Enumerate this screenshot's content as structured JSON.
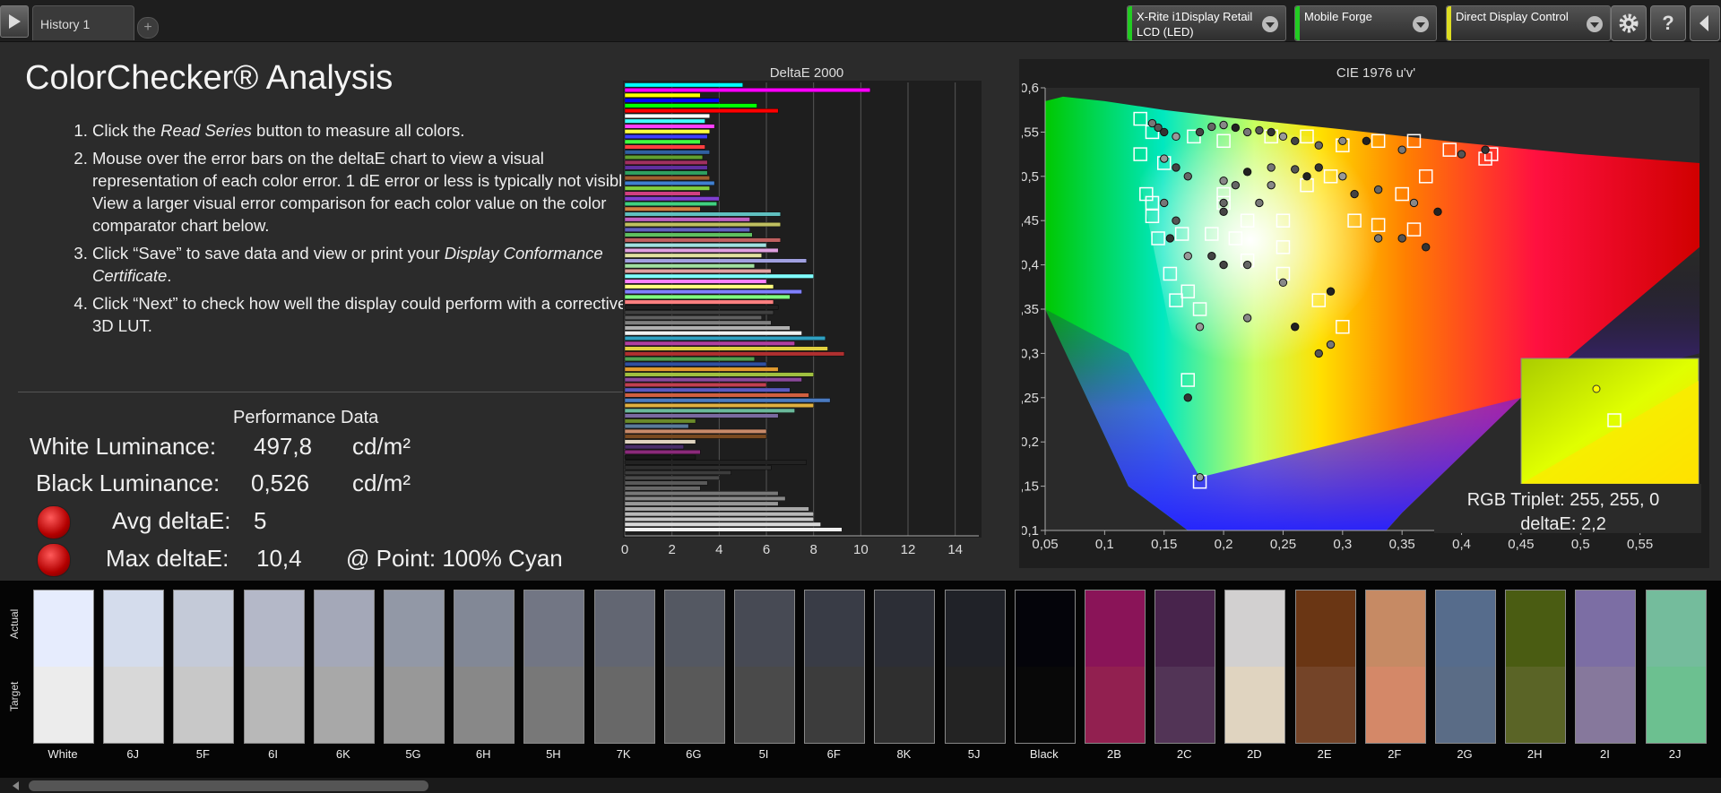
{
  "tabs": {
    "history": "History 1",
    "add": "+"
  },
  "devices": [
    {
      "line1": "X-Rite i1Display Retail",
      "line2": "LCD (LED)",
      "status_color": "#22cc22"
    },
    {
      "line1": "Mobile Forge",
      "line2": "",
      "status_color": "#22cc22"
    },
    {
      "line1": "Direct Display Control",
      "line2": "",
      "status_color": "#dddd22"
    }
  ],
  "toolbar": {
    "help": "?"
  },
  "title": "ColorChecker® Analysis",
  "instructions": {
    "s1_pre": "Click the ",
    "s1_em": "Read Series",
    "s1_post": " button to measure all colors.",
    "s2a": "Mouse over the error bars on the deltaE chart to view a visual representation of each color error. 1 dE error or less is typically not visible.",
    "s2b": "View a larger visual error comparison for each color value on the color comparator chart below.",
    "s3_pre": "Click “Save” to save data and view or print your ",
    "s3_em": "Display Conformance Certificate",
    "s3_post": ".",
    "s4": "Click “Next” to check how well the display could perform with a corrective 3D LUT."
  },
  "performance": {
    "title": "Performance Data",
    "white_label": "White Luminance:",
    "white_value": "497,8",
    "white_unit": "cd/m²",
    "black_label": "Black Luminance:",
    "black_value": "0,526",
    "black_unit": "cd/m²",
    "avg_label": "Avg deltaE:",
    "avg_value": "5",
    "max_label": "Max deltaE:",
    "max_value": "10,4",
    "max_point": "@ Point: 100% Cyan"
  },
  "chart_data": [
    {
      "type": "bar",
      "orientation": "horizontal",
      "title": "DeltaE 2000",
      "xlim": [
        0,
        15
      ],
      "xticks": [
        0,
        2,
        4,
        6,
        8,
        10,
        12,
        14
      ],
      "bar_colors": [
        "#f0f0f0",
        "#d8d8d8",
        "#c8c8c8",
        "#b8b8b8",
        "#a8a8a8",
        "#989898",
        "#888888",
        "#787878",
        "#686868",
        "#5a5a5a",
        "#4a4a4a",
        "#3c3c3c",
        "#2e2e2e",
        "#222222",
        "#181818",
        "#8a2a7a",
        "#4a2e6a",
        "#e0d4c0",
        "#7a4a20",
        "#c88a6a",
        "#5a7a9a",
        "#6a8a2a",
        "#7a6aa0",
        "#6ab89a",
        "#e0b040",
        "#4a7ac0",
        "#d06040",
        "#5a5ac0",
        "#c04050",
        "#8a4a9a",
        "#a0c040",
        "#e09a30",
        "#3050a0",
        "#50a050",
        "#b03030",
        "#e0d040",
        "#b040a0",
        "#30a0c0",
        "#f0f0f0",
        "#b0b0b0",
        "#808080",
        "#606060",
        "#404040",
        "#202020",
        "#ff8080",
        "#80ff80",
        "#8080ff",
        "#ffff80",
        "#ff80ff",
        "#80ffff",
        "#e0a0a0",
        "#a0e0a0",
        "#a0a0e0",
        "#e0e0a0",
        "#e0a0e0",
        "#a0e0e0",
        "#c06060",
        "#60c060",
        "#6060c0",
        "#c0c060",
        "#c060c0",
        "#60c0c0",
        "#d08040",
        "#40d080",
        "#8040d0",
        "#d04080",
        "#80d040",
        "#4080d0",
        "#a06030",
        "#30a060",
        "#6030a0",
        "#a03060",
        "#60a030",
        "#3060a0",
        "#ff4040",
        "#40ff40",
        "#4040ff",
        "#ffff40",
        "#ff40ff",
        "#40ffff",
        "#ffffff",
        "#ff0000",
        "#00ff00",
        "#0000ff",
        "#ffff00",
        "#ff00ff",
        "#00ffff"
      ],
      "values": [
        9.2,
        8.3,
        8.0,
        8.0,
        7.8,
        6.5,
        6.8,
        6.5,
        3.2,
        3.5,
        4.0,
        4.5,
        6.2,
        7.7,
        3.0,
        3.2,
        2.5,
        3.0,
        6.0,
        6.0,
        2.7,
        3.0,
        6.5,
        7.2,
        8.0,
        8.7,
        7.8,
        7.0,
        6.0,
        7.5,
        8.0,
        6.5,
        6.0,
        5.5,
        9.3,
        8.6,
        7.2,
        8.5,
        7.5,
        7.0,
        6.2,
        5.8,
        6.3,
        6.5,
        6.3,
        7.0,
        7.5,
        6.3,
        6.0,
        8.0,
        6.2,
        5.5,
        7.7,
        5.8,
        6.5,
        6.0,
        6.6,
        5.4,
        5.3,
        6.6,
        5.3,
        6.6,
        3.2,
        3.9,
        4.0,
        3.2,
        3.6,
        3.8,
        3.6,
        3.5,
        3.5,
        3.5,
        3.3,
        3.6,
        3.4,
        3.2,
        3.5,
        3.6,
        3.8,
        3.4,
        3.6,
        6.5,
        5.6,
        4.0,
        3.2,
        10.4,
        5.0
      ]
    },
    {
      "type": "scatter",
      "title": "CIE 1976 u'v'",
      "xlim": [
        0.05,
        0.6
      ],
      "ylim": [
        0.1,
        0.6
      ],
      "xticks": [
        "0,05",
        "0,1",
        "0,15",
        "0,2",
        "0,25",
        "0,3",
        "0,35",
        "0,4",
        "0,45",
        "0,5",
        "0,55"
      ],
      "yticks": [
        "0,1",
        "0,15",
        "0,2",
        "0,25",
        "0,3",
        "0,35",
        "0,4",
        "0,45",
        "0,5",
        "0,55",
        "0,6"
      ],
      "series": [
        {
          "kind": "measured",
          "points": [
            [
              0.14,
              0.56
            ],
            [
              0.145,
              0.555
            ],
            [
              0.15,
              0.55
            ],
            [
              0.16,
              0.545
            ],
            [
              0.18,
              0.55
            ],
            [
              0.19,
              0.556
            ],
            [
              0.2,
              0.558
            ],
            [
              0.21,
              0.555
            ],
            [
              0.22,
              0.55
            ],
            [
              0.23,
              0.552
            ],
            [
              0.24,
              0.55
            ],
            [
              0.25,
              0.545
            ],
            [
              0.26,
              0.54
            ],
            [
              0.28,
              0.535
            ],
            [
              0.3,
              0.54
            ],
            [
              0.32,
              0.54
            ],
            [
              0.35,
              0.53
            ],
            [
              0.4,
              0.525
            ],
            [
              0.42,
              0.53
            ],
            [
              0.15,
              0.52
            ],
            [
              0.16,
              0.51
            ],
            [
              0.17,
              0.5
            ],
            [
              0.2,
              0.495
            ],
            [
              0.22,
              0.505
            ],
            [
              0.24,
              0.51
            ],
            [
              0.26,
              0.508
            ],
            [
              0.28,
              0.51
            ],
            [
              0.3,
              0.5
            ],
            [
              0.31,
              0.48
            ],
            [
              0.33,
              0.485
            ],
            [
              0.36,
              0.47
            ],
            [
              0.38,
              0.46
            ],
            [
              0.15,
              0.47
            ],
            [
              0.16,
              0.45
            ],
            [
              0.155,
              0.43
            ],
            [
              0.17,
              0.41
            ],
            [
              0.2,
              0.4
            ],
            [
              0.22,
              0.4
            ],
            [
              0.25,
              0.38
            ],
            [
              0.29,
              0.37
            ],
            [
              0.33,
              0.43
            ],
            [
              0.35,
              0.43
            ],
            [
              0.37,
              0.42
            ],
            [
              0.18,
              0.33
            ],
            [
              0.2,
              0.46
            ],
            [
              0.2,
              0.47
            ],
            [
              0.22,
              0.34
            ],
            [
              0.26,
              0.33
            ],
            [
              0.29,
              0.31
            ],
            [
              0.28,
              0.3
            ],
            [
              0.17,
              0.25
            ],
            [
              0.18,
              0.16
            ],
            [
              0.19,
              0.41
            ],
            [
              0.21,
              0.49
            ],
            [
              0.24,
              0.49
            ],
            [
              0.27,
              0.5
            ],
            [
              0.23,
              0.47
            ]
          ]
        },
        {
          "kind": "target",
          "points": [
            [
              0.13,
              0.565
            ],
            [
              0.14,
              0.55
            ],
            [
              0.175,
              0.545
            ],
            [
              0.2,
              0.54
            ],
            [
              0.24,
              0.545
            ],
            [
              0.27,
              0.545
            ],
            [
              0.3,
              0.535
            ],
            [
              0.33,
              0.54
            ],
            [
              0.36,
              0.54
            ],
            [
              0.39,
              0.53
            ],
            [
              0.42,
              0.52
            ],
            [
              0.425,
              0.525
            ],
            [
              0.13,
              0.525
            ],
            [
              0.15,
              0.515
            ],
            [
              0.135,
              0.48
            ],
            [
              0.14,
              0.47
            ],
            [
              0.14,
              0.455
            ],
            [
              0.145,
              0.43
            ],
            [
              0.165,
              0.435
            ],
            [
              0.19,
              0.435
            ],
            [
              0.21,
              0.43
            ],
            [
              0.155,
              0.39
            ],
            [
              0.17,
              0.37
            ],
            [
              0.16,
              0.36
            ],
            [
              0.18,
              0.35
            ],
            [
              0.22,
              0.405
            ],
            [
              0.25,
              0.39
            ],
            [
              0.25,
              0.42
            ],
            [
              0.28,
              0.36
            ],
            [
              0.3,
              0.33
            ],
            [
              0.31,
              0.45
            ],
            [
              0.33,
              0.445
            ],
            [
              0.36,
              0.44
            ],
            [
              0.35,
              0.48
            ],
            [
              0.37,
              0.5
            ],
            [
              0.2,
              0.47
            ],
            [
              0.22,
              0.45
            ],
            [
              0.25,
              0.45
            ],
            [
              0.27,
              0.49
            ],
            [
              0.29,
              0.5
            ],
            [
              0.17,
              0.27
            ],
            [
              0.18,
              0.155
            ],
            [
              0.2,
              0.48
            ]
          ]
        }
      ]
    }
  ],
  "zoom": {
    "rgb_label": "RGB Triplet: 255, 255, 0",
    "de_label": "deltaE: 2,2"
  },
  "patches": {
    "actual_label": "Actual",
    "target_label": "Target",
    "items": [
      {
        "label": "White",
        "actual": "#e6ecfd",
        "target": "#ececec"
      },
      {
        "label": "6J",
        "actual": "#d4dcec",
        "target": "#d8d8d8"
      },
      {
        "label": "5F",
        "actual": "#c4cad8",
        "target": "#c8c8c8"
      },
      {
        "label": "6I",
        "actual": "#b4b8c8",
        "target": "#b8b8b8"
      },
      {
        "label": "6K",
        "actual": "#a4a8b8",
        "target": "#a8a8a8"
      },
      {
        "label": "5G",
        "actual": "#9298a6",
        "target": "#989898"
      },
      {
        "label": "6H",
        "actual": "#828896",
        "target": "#888888"
      },
      {
        "label": "5H",
        "actual": "#727684",
        "target": "#787878"
      },
      {
        "label": "7K",
        "actual": "#626672",
        "target": "#686868"
      },
      {
        "label": "6G",
        "actual": "#545862",
        "target": "#595959"
      },
      {
        "label": "5I",
        "actual": "#474a54",
        "target": "#4a4a4a"
      },
      {
        "label": "6F",
        "actual": "#393c46",
        "target": "#3c3c3c"
      },
      {
        "label": "8K",
        "actual": "#2c2e36",
        "target": "#2f2f2f"
      },
      {
        "label": "5J",
        "actual": "#202228",
        "target": "#232323"
      },
      {
        "label": "Black",
        "actual": "#04040a",
        "target": "#080808"
      },
      {
        "label": "2B",
        "actual": "#8a1458",
        "target": "#922050"
      },
      {
        "label": "2C",
        "actual": "#48244c",
        "target": "#523456"
      },
      {
        "label": "2D",
        "actual": "#d2d0d0",
        "target": "#e0d4c0"
      },
      {
        "label": "2E",
        "actual": "#6a3614",
        "target": "#744428"
      },
      {
        "label": "2F",
        "actual": "#c68a64",
        "target": "#d48868"
      },
      {
        "label": "2G",
        "actual": "#566c8c",
        "target": "#5a6c86"
      },
      {
        "label": "2H",
        "actual": "#4a5c12",
        "target": "#5a6426"
      },
      {
        "label": "2I",
        "actual": "#7c6ea4",
        "target": "#86789c"
      },
      {
        "label": "2J",
        "actual": "#74bc9c",
        "target": "#6cc090"
      }
    ]
  }
}
